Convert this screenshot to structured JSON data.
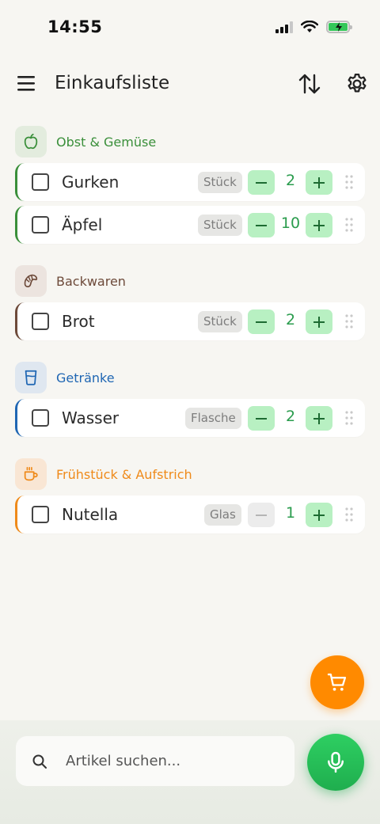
{
  "status_bar": {
    "time": "14:55"
  },
  "header": {
    "title": "Einkaufsliste"
  },
  "categories": [
    {
      "name": "Obst & Gemüse",
      "color": "#3a8f3a",
      "icon_bg": "#e3ecde",
      "icon": "apple-icon",
      "items": [
        {
          "name": "Gurken",
          "unit": "Stück",
          "qty": "2",
          "minus_disabled": false
        },
        {
          "name": "Äpfel",
          "unit": "Stück",
          "qty": "10",
          "minus_disabled": false
        }
      ]
    },
    {
      "name": "Backwaren",
      "color": "#6d4a3a",
      "icon_bg": "#ece4df",
      "icon": "croissant-icon",
      "items": [
        {
          "name": "Brot",
          "unit": "Stück",
          "qty": "2",
          "minus_disabled": false
        }
      ]
    },
    {
      "name": "Getränke",
      "color": "#1f66b3",
      "icon_bg": "#dfe7f0",
      "icon": "glass-icon",
      "items": [
        {
          "name": "Wasser",
          "unit": "Flasche",
          "qty": "2",
          "minus_disabled": false
        }
      ]
    },
    {
      "name": "Frühstück & Aufstrich",
      "color": "#ef8a1a",
      "icon_bg": "#f9e6d4",
      "icon": "cup-icon",
      "items": [
        {
          "name": "Nutella",
          "unit": "Glas",
          "qty": "1",
          "minus_disabled": true
        }
      ]
    }
  ],
  "search": {
    "placeholder": "Artikel suchen..."
  },
  "colors": {
    "accent_green": "#2a9c4d",
    "cart_orange": "#ff8a00"
  }
}
